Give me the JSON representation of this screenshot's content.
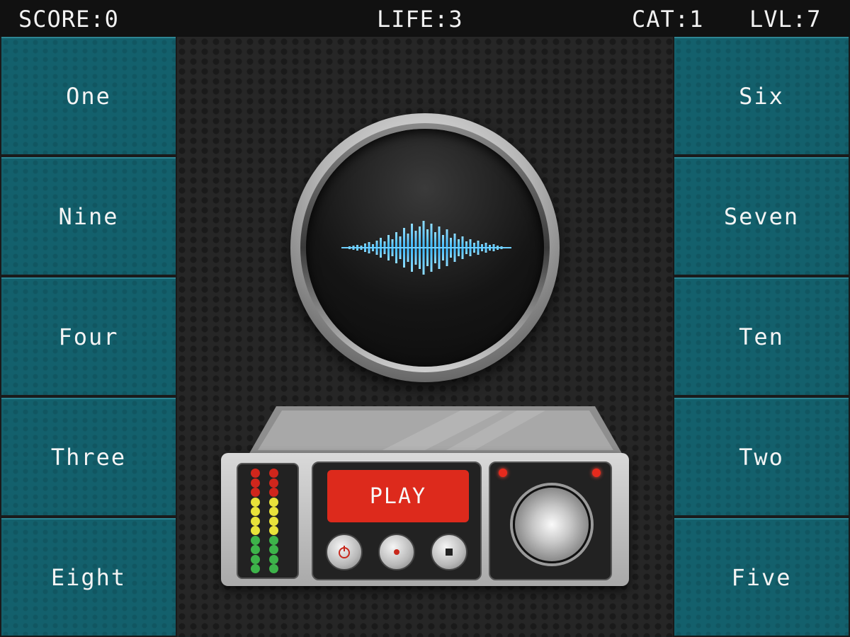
{
  "hud": {
    "score": "SCORE:0",
    "life": "LIFE:3",
    "cat": "CAT:1",
    "lvl": "LVL:7"
  },
  "left_tiles": [
    "One",
    "Nine",
    "Four",
    "Three",
    "Eight"
  ],
  "right_tiles": [
    "Six",
    "Seven",
    "Ten",
    "Two",
    "Five"
  ],
  "device": {
    "play_label": "PLAY",
    "buttons": [
      "power-icon",
      "record-icon",
      "stop-icon"
    ]
  },
  "colors": {
    "tile": "#13606c",
    "play": "#dd2a1c",
    "wave": "#3ab8ff"
  }
}
